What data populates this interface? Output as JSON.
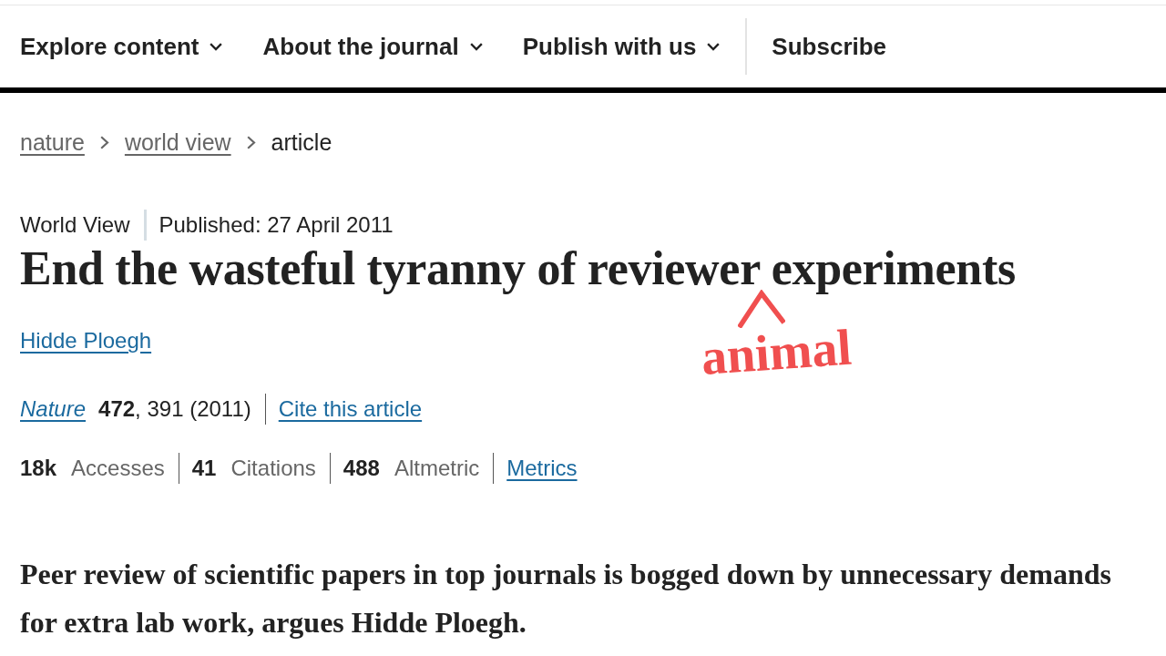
{
  "nav": {
    "items": [
      {
        "label": "Explore content",
        "dropdown": true
      },
      {
        "label": "About the journal",
        "dropdown": true
      },
      {
        "label": "Publish with us",
        "dropdown": true
      },
      {
        "label": "Subscribe",
        "dropdown": false
      }
    ]
  },
  "breadcrumb": [
    {
      "label": "nature",
      "current": false
    },
    {
      "label": "world view",
      "current": false
    },
    {
      "label": "article",
      "current": true
    }
  ],
  "article": {
    "type": "World View",
    "published": "Published: 27 April 2011",
    "title": "End the wasteful tyranny of reviewer experiments",
    "authors": [
      "Hidde Ploegh"
    ],
    "citation": {
      "journal": "Nature",
      "details": "**472**, 391 (2011)",
      "cite_link": "Cite this article"
    },
    "metrics": [
      {
        "count": "18k",
        "name": "Accesses"
      },
      {
        "count": "41",
        "name": "Citations"
      },
      {
        "count": "488",
        "name": "Altmetric"
      }
    ],
    "metrics_link": "Metrics",
    "standfirst": "Peer review of scientific papers in top journals is bogged down by unnecessary demands for extra lab work, argues Hidde Ploegh."
  },
  "annotation": {
    "text": "animal"
  }
}
